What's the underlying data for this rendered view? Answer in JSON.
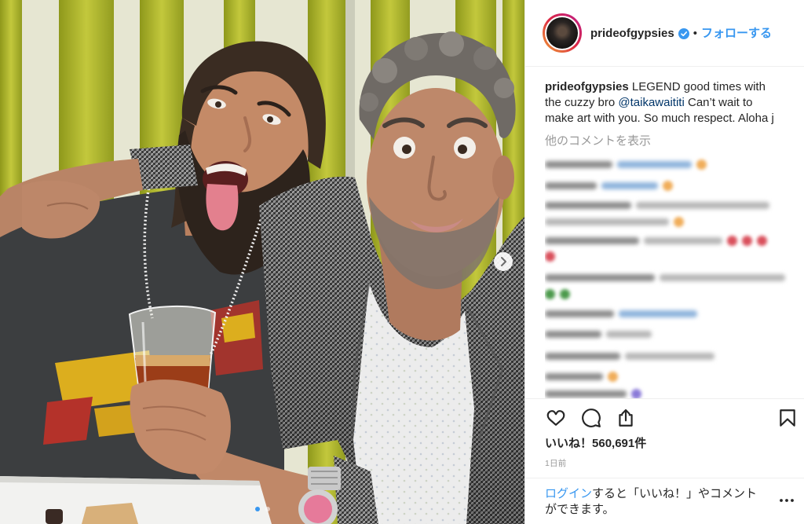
{
  "post": {
    "username": "prideofgypsies",
    "verified": true,
    "separator": "•",
    "follow_label": "フォローする",
    "caption": {
      "username": "prideofgypsies",
      "text_before_mention": " LEGEND good times with the cuzzy bro ",
      "mention": "@taikawaititi",
      "text_after_mention": " Can’t wait to make art with you. So much respect. Aloha j"
    },
    "view_comments_label": "他のコメントを表示",
    "likes_label": "いいね！",
    "likes_count": "560,691件",
    "timestamp": "1日前",
    "login_prompt": {
      "link": "ログイン",
      "text": "すると「いいね！」やコメントができます。"
    }
  },
  "carousel": {
    "slide_count": 2,
    "active_slide": 1,
    "has_next": true
  },
  "icons": {
    "verified": "verified-badge-icon",
    "like": "heart-icon",
    "comment": "comment-icon",
    "share": "share-icon",
    "save": "bookmark-icon",
    "more": "more-options-icon",
    "next": "chevron-right-icon"
  },
  "colors": {
    "accent": "#3897f0",
    "text": "#262626",
    "muted": "#999999",
    "divider": "#efefef",
    "story_ring": [
      "#f09433",
      "#dc2743",
      "#bc1888"
    ]
  }
}
